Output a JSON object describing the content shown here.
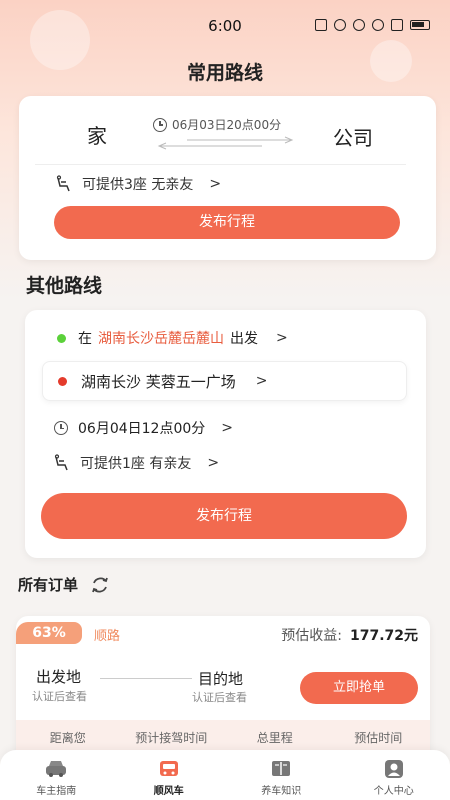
{
  "status_bar": {
    "time": "6:00"
  },
  "page": {
    "title": "常用路线"
  },
  "common_route": {
    "from": "家",
    "to": "公司",
    "datetime": "06月03日20点00分",
    "seats": "可提供3座 无亲友",
    "publish_label": "发布行程"
  },
  "other_routes": {
    "title": "其他路线",
    "start_prefix": "在",
    "start_place": "湖南长沙岳麓岳麓山",
    "start_suffix": "出发",
    "destination": "湖南长沙 芙蓉五一广场",
    "datetime": "06月04日12点00分",
    "seats": "可提供1座 有亲友",
    "publish_label": "发布行程",
    "start_dot_color": "#5bd13a",
    "dest_dot_color": "#e43b2c"
  },
  "orders": {
    "title": "所有订单",
    "item": {
      "percent": "63%",
      "tag": "顺路",
      "earn_label": "预估收益:",
      "earn_value": "177.72元",
      "origin_label": "出发地",
      "origin_sub": "认证后查看",
      "dest_label": "目的地",
      "dest_sub": "认证后查看",
      "grab_label": "立即抢单",
      "stats": [
        "距离您",
        "预计接驾时间",
        "总里程",
        "预估时间"
      ]
    }
  },
  "tabs": [
    {
      "label": "车主指南",
      "icon": "car-icon"
    },
    {
      "label": "顺风车",
      "icon": "rideshare-icon"
    },
    {
      "label": "养车知识",
      "icon": "book-icon"
    },
    {
      "label": "个人中心",
      "icon": "user-icon"
    }
  ],
  "colors": {
    "accent": "#f26a4f",
    "badge": "#f5a07a"
  }
}
